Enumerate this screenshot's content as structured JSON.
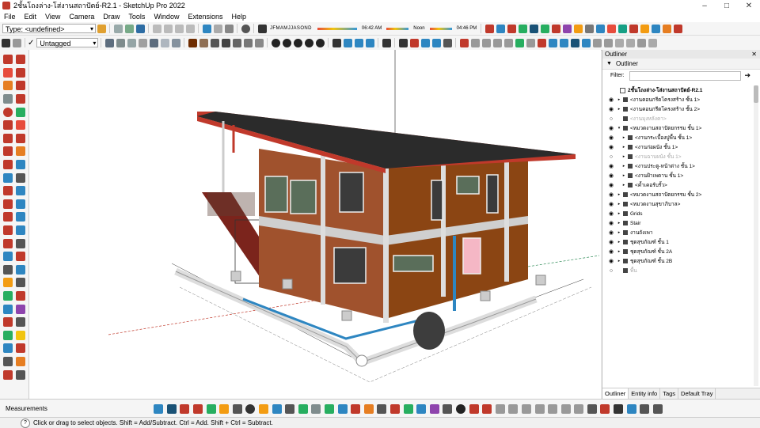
{
  "window": {
    "title": "2ชั้นโถงล่าง-โส่งานสถาปัตย์-R2.1 - SketchUp Pro 2022",
    "minimize": "–",
    "maximize": "□",
    "close": "✕"
  },
  "menu": [
    "File",
    "Edit",
    "View",
    "Camera",
    "Draw",
    "Tools",
    "Window",
    "Extensions",
    "Help"
  ],
  "toolbar": {
    "type_combo": "Type: <undefined>",
    "tag_combo": "Untagged",
    "months": [
      "J",
      "F",
      "M",
      "A",
      "M",
      "J",
      "J",
      "A",
      "S",
      "O",
      "N",
      "D"
    ],
    "time_start": "06:42 AM",
    "time_noon": "Noon",
    "time_end": "04:46 PM"
  },
  "outliner": {
    "panel_title": "Outliner",
    "sub_title": "Outliner",
    "filter_label": "Filter:",
    "close_glyph": "✕",
    "model_name": "2ชั้นโถงล่าง-โส่งานสถาปัตย์-R2.1",
    "rows": [
      {
        "label": "<งานคอนกรีตโครงสร้าง ชั้น 1>",
        "depth": 1,
        "visible": true,
        "expand": "▸"
      },
      {
        "label": "<งานคอนกรีตโครงสร้าง ชั้น 2>",
        "depth": 1,
        "visible": true,
        "expand": "▸"
      },
      {
        "label": "<งานมุงหลังคา>",
        "depth": 1,
        "visible": false,
        "expand": ""
      },
      {
        "label": "<หมวดงานสถาปัตยกรรม ชั้น 1>",
        "depth": 1,
        "visible": true,
        "expand": "▾"
      },
      {
        "label": "<งานกระเบื้องปูพื้น ชั้น 1>",
        "depth": 2,
        "visible": true,
        "expand": "▸"
      },
      {
        "label": "<งานก่อผนัง ชั้น 1>",
        "depth": 2,
        "visible": true,
        "expand": "▸"
      },
      {
        "label": "<งานฉาบผนัง ชั้น 1>",
        "depth": 2,
        "visible": false,
        "expand": "▸"
      },
      {
        "label": "<งานประตู-หน้าต่าง ชั้น 1>",
        "depth": 2,
        "visible": true,
        "expand": "▸"
      },
      {
        "label": "<งานฝ้าเพดาน ชั้น 1>",
        "depth": 2,
        "visible": true,
        "expand": "▸"
      },
      {
        "label": "<ค้ำเคอร์บรั้ว>",
        "depth": 2,
        "visible": true,
        "expand": "▸"
      },
      {
        "label": "<หมวดงานสถาปัตยกรรม ชั้น 2>",
        "depth": 1,
        "visible": true,
        "expand": "▸"
      },
      {
        "label": "<หมวดงานสุขาภิบาล>",
        "depth": 1,
        "visible": true,
        "expand": "▸"
      },
      {
        "label": "Grids",
        "depth": 1,
        "visible": true,
        "expand": "▸"
      },
      {
        "label": "Stair",
        "depth": 1,
        "visible": true,
        "expand": "▸"
      },
      {
        "label": "งานถังเพา",
        "depth": 1,
        "visible": true,
        "expand": "▸"
      },
      {
        "label": "ชุดสุขภัณฑ์ ชั้น 1",
        "depth": 1,
        "visible": true,
        "expand": "▸"
      },
      {
        "label": "ชุดสุขภัณฑ์ ชั้น 2A",
        "depth": 1,
        "visible": true,
        "expand": "▸"
      },
      {
        "label": "ชุดสุขภัณฑ์ ชั้น 2B",
        "depth": 1,
        "visible": true,
        "expand": "▸"
      },
      {
        "label": "พื้น",
        "depth": 1,
        "visible": false,
        "expand": ""
      }
    ],
    "tabs": [
      "Outliner",
      "Entity info",
      "Tags",
      "Default Tray"
    ]
  },
  "measurements_label": "Measurements",
  "status_text": "Click or drag to select objects. Shift = Add/Subtract. Ctrl = Add. Shift + Ctrl = Subtract.",
  "status_icon": "?",
  "icons": {
    "eye": "◉",
    "hidden": "○",
    "colors": [
      "#c0392b",
      "#2e86c1",
      "#27ae60",
      "#f39c12",
      "#7f8c8d",
      "#8e44ad",
      "#34495e",
      "#16a085"
    ]
  }
}
